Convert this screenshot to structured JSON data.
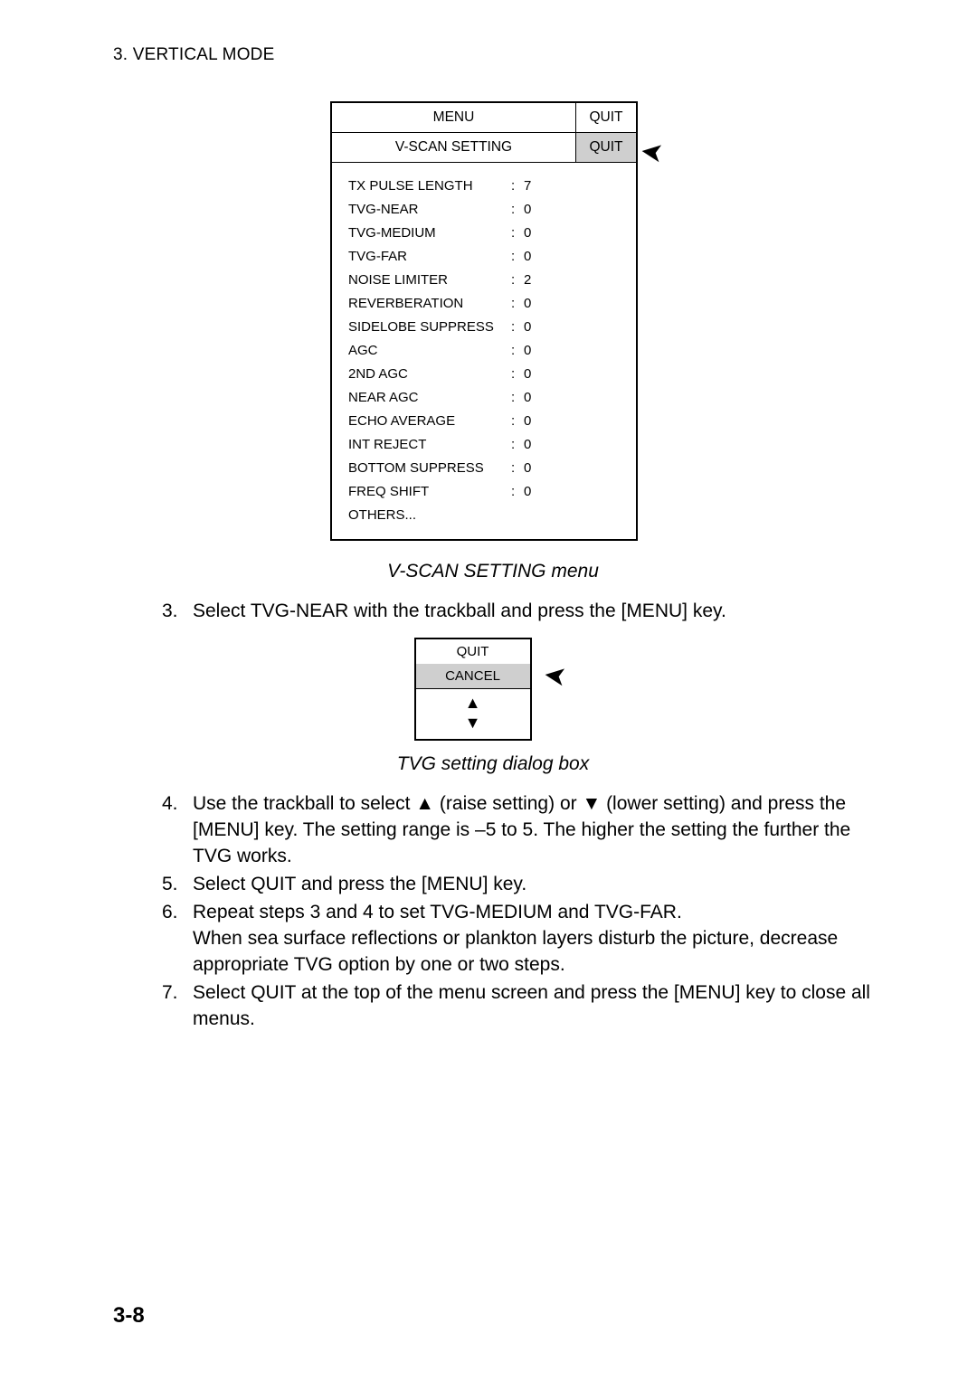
{
  "header": "3.  VERTICAL MODE",
  "menu": {
    "title": "MENU",
    "quit_top": "QUIT",
    "subtitle": "V-SCAN SETTING",
    "quit_sub": "QUIT",
    "items": [
      {
        "label": "TX PULSE LENGTH",
        "value": "7"
      },
      {
        "label": "TVG-NEAR",
        "value": "0"
      },
      {
        "label": "TVG-MEDIUM",
        "value": "0"
      },
      {
        "label": "TVG-FAR",
        "value": "0"
      },
      {
        "label": "NOISE LIMITER",
        "value": "2"
      },
      {
        "label": "REVERBERATION",
        "value": "0"
      },
      {
        "label": "SIDELOBE SUPPRESS",
        "value": "0"
      },
      {
        "label": "AGC",
        "value": "0"
      },
      {
        "label": "2ND AGC",
        "value": "0"
      },
      {
        "label": "NEAR AGC",
        "value": "0"
      },
      {
        "label": "ECHO AVERAGE",
        "value": "0"
      },
      {
        "label": "INT REJECT",
        "value": "0"
      },
      {
        "label": "BOTTOM SUPPRESS",
        "value": "0"
      },
      {
        "label": "FREQ SHIFT",
        "value": "0"
      },
      {
        "label": "OTHERS...",
        "value": ""
      }
    ]
  },
  "caption1": "V-SCAN SETTING menu",
  "step3": "Select TVG-NEAR with the trackball and press the [MENU] key.",
  "dialog": {
    "quit": "QUIT",
    "cancel": "CANCEL"
  },
  "caption2": "TVG setting dialog box",
  "step4": "Use the trackball to select ▲ (raise setting) or ▼ (lower setting) and press the [MENU] key. The setting range is –5 to 5. The higher the setting the further the TVG works.",
  "step5": "Select QUIT and press the [MENU] key.",
  "step6": "Repeat steps 3 and 4 to set TVG-MEDIUM and TVG-FAR.\nWhen sea surface reflections or plankton layers disturb the picture, decrease appropriate TVG option by one or two steps.",
  "step7": "Select QUIT at the top of the menu screen and press the [MENU] key to close all menus.",
  "page_number": "3-8"
}
